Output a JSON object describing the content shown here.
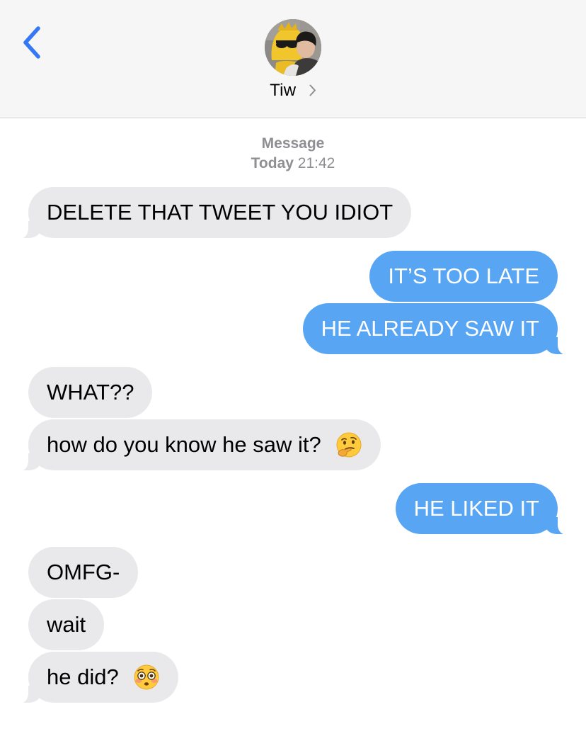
{
  "header": {
    "contact_name": "Tiw",
    "back_icon": "chevron-left-icon",
    "disclosure_icon": "chevron-right-icon",
    "avatar": "contact-avatar"
  },
  "conversation": {
    "service_label": "Message",
    "day_label": "Today",
    "time_label": "21:42"
  },
  "messages": [
    {
      "direction": "incoming",
      "text": "DELETE THAT TWEET YOU IDIOT"
    },
    {
      "direction": "outgoing",
      "text": "IT’S TOO LATE"
    },
    {
      "direction": "outgoing",
      "text": "HE ALREADY SAW IT"
    },
    {
      "direction": "incoming",
      "text": "WHAT??"
    },
    {
      "direction": "incoming",
      "text": "how do you know he saw it?",
      "emoji": "thinking-face-emoji"
    },
    {
      "direction": "outgoing",
      "text": "HE LIKED IT"
    },
    {
      "direction": "incoming",
      "text": "OMFG-"
    },
    {
      "direction": "incoming",
      "text": "wait"
    },
    {
      "direction": "incoming",
      "text": "he did?",
      "emoji": "flushed-face-emoji"
    }
  ],
  "colors": {
    "outgoing_bubble": "#57a5f3",
    "incoming_bubble": "#e9e9eb",
    "ios_blue": "#3478f6",
    "header_background": "#f6f6f6",
    "meta_text": "#8e8e93"
  }
}
